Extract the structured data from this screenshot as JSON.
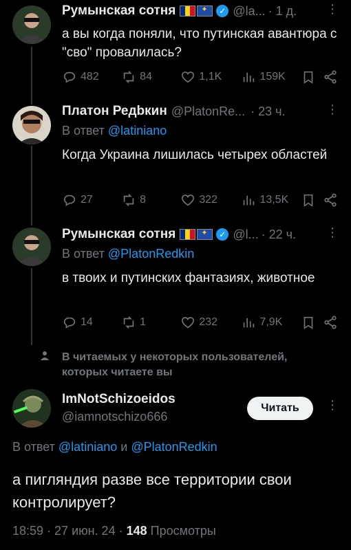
{
  "tweets": [
    {
      "name": "Румынская сотня",
      "handle": "@la...",
      "time": "· 1 д.",
      "body": "а вы когда поняли, что путинская авантюра с \"сво\" провалилась?",
      "stats": {
        "replies": "482",
        "reposts": "84",
        "likes": "1,1K",
        "views": "159K"
      }
    },
    {
      "name": "Платон Редbкин",
      "handle": "@PlatonRe...",
      "time": "· 23 ч.",
      "reply_prefix": "В ответ",
      "reply_to": "@latiniano",
      "body": "Когда Украина лишилась четырех областей",
      "stats": {
        "replies": "27",
        "reposts": "8",
        "likes": "322",
        "views": "13,5K"
      }
    },
    {
      "name": "Румынская сотня",
      "handle": "@l...",
      "time": "· 22 ч.",
      "reply_prefix": "В ответ",
      "reply_to": "@PlatonRedkin",
      "body": "в твоих и путинских фантазиях, животное",
      "stats": {
        "replies": "14",
        "reposts": "1",
        "likes": "232",
        "views": "7,9K"
      }
    }
  ],
  "notice": "В читаемых у некоторых пользователей, которых читаете вы",
  "main": {
    "name": "ImNotSchizoeidos",
    "handle": "@iamnotschizo666",
    "follow_label": "Читать",
    "reply_prefix": "В ответ",
    "reply_to_1": "@latiniano",
    "reply_and": "и",
    "reply_to_2": "@PlatonRedkin",
    "body": "а пигляндия разве все территории свои контролирует?",
    "time": "18:59 · 27 июн. 24 ·",
    "views_count": "148",
    "views_label": "Просмотры"
  },
  "colors": {
    "background": "#000000",
    "text": "#e7e9ea",
    "muted": "#71767b",
    "link": "#1d9bf0",
    "line": "#333639"
  },
  "icons": [
    "reply-icon",
    "repost-icon",
    "like-icon",
    "views-icon",
    "bookmark-icon",
    "share-icon",
    "verified-icon",
    "more-icon",
    "person-icon"
  ]
}
